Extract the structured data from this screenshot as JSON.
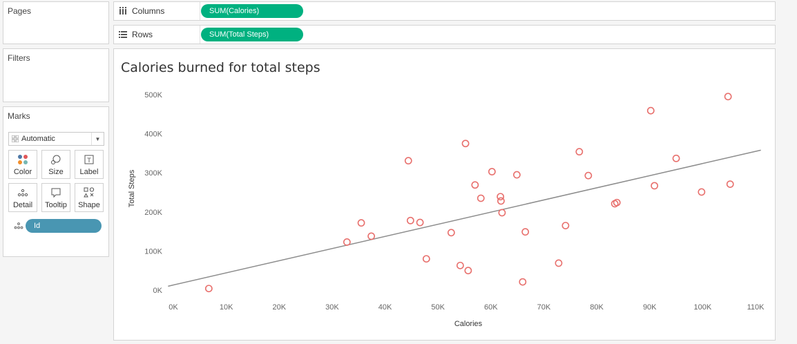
{
  "panels": {
    "pages_title": "Pages",
    "filters_title": "Filters",
    "marks_title": "Marks"
  },
  "marks": {
    "type_value": "Automatic",
    "buttons": [
      {
        "label": "Color",
        "icon": "color-icon"
      },
      {
        "label": "Size",
        "icon": "size-icon"
      },
      {
        "label": "Label",
        "icon": "label-icon"
      },
      {
        "label": "Detail",
        "icon": "detail-icon"
      },
      {
        "label": "Tooltip",
        "icon": "tooltip-icon"
      },
      {
        "label": "Shape",
        "icon": "shape-icon"
      }
    ],
    "detail_field": "Id"
  },
  "shelves": {
    "columns_label": "Columns",
    "columns_pill": "SUM(Calories)",
    "rows_label": "Rows",
    "rows_pill": "SUM(Total Steps)"
  },
  "colors": {
    "pill_green": "#00b180",
    "pill_blue": "#4996b2",
    "point_stroke": "#e8706d",
    "trend_line": "#8c8c8c"
  },
  "chart_data": {
    "type": "scatter",
    "title": "Calories burned for total steps",
    "xlabel": "Calories",
    "ylabel": "Total Steps",
    "xlim": [
      0,
      110000
    ],
    "ylim": [
      0,
      500000
    ],
    "x_ticks": [
      "0K",
      "10K",
      "20K",
      "30K",
      "40K",
      "50K",
      "60K",
      "70K",
      "80K",
      "90K",
      "100K",
      "110K"
    ],
    "y_ticks": [
      "0K",
      "100K",
      "200K",
      "300K",
      "400K",
      "500K"
    ],
    "trend_line": {
      "x": [
        -1000,
        111000
      ],
      "y": [
        10000,
        358000
      ]
    },
    "grid": false,
    "points": [
      {
        "x": 6700,
        "y": 4000
      },
      {
        "x": 32800,
        "y": 123000
      },
      {
        "x": 35500,
        "y": 172000
      },
      {
        "x": 37400,
        "y": 138000
      },
      {
        "x": 44400,
        "y": 331000
      },
      {
        "x": 44800,
        "y": 178000
      },
      {
        "x": 46600,
        "y": 173000
      },
      {
        "x": 47800,
        "y": 80000
      },
      {
        "x": 52500,
        "y": 147000
      },
      {
        "x": 54200,
        "y": 63000
      },
      {
        "x": 55200,
        "y": 375000
      },
      {
        "x": 55700,
        "y": 50000
      },
      {
        "x": 57000,
        "y": 269000
      },
      {
        "x": 58100,
        "y": 235000
      },
      {
        "x": 60200,
        "y": 303000
      },
      {
        "x": 61800,
        "y": 239000
      },
      {
        "x": 61900,
        "y": 228000
      },
      {
        "x": 62100,
        "y": 198000
      },
      {
        "x": 64900,
        "y": 295000
      },
      {
        "x": 66000,
        "y": 21000
      },
      {
        "x": 66500,
        "y": 149000
      },
      {
        "x": 72800,
        "y": 69000
      },
      {
        "x": 74100,
        "y": 165000
      },
      {
        "x": 76700,
        "y": 354000
      },
      {
        "x": 78400,
        "y": 293000
      },
      {
        "x": 83400,
        "y": 221000
      },
      {
        "x": 83800,
        "y": 224000
      },
      {
        "x": 90200,
        "y": 459000
      },
      {
        "x": 90900,
        "y": 267000
      },
      {
        "x": 95000,
        "y": 337000
      },
      {
        "x": 99800,
        "y": 251000
      },
      {
        "x": 104800,
        "y": 495000
      },
      {
        "x": 105200,
        "y": 271000
      }
    ]
  }
}
